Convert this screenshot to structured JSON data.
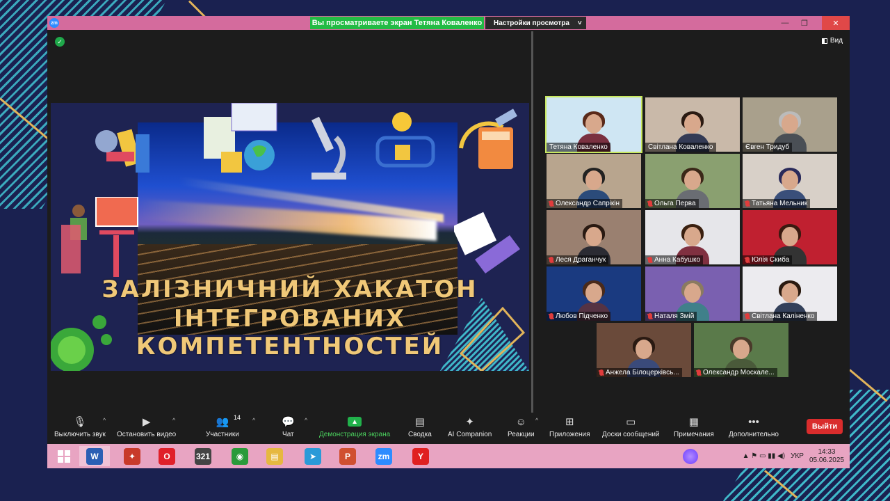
{
  "titlebar": {
    "logo": "zm",
    "banner": "Вы просматриваете экран Тетяна  Коваленко",
    "settings": "Настройки просмотра",
    "settings_caret": "˅",
    "min": "—",
    "restore": "❐",
    "close": "✕"
  },
  "view_button": "Вид",
  "slide": {
    "line1": "ЗАЛІЗНИЧНИЙ ХАКАТОН",
    "line2": "ІНТЕГРОВАНИХ",
    "line3": "КОМПЕТЕНТНОСТЕЙ"
  },
  "participants": [
    {
      "name": "Тетяна  Коваленко",
      "muted": false,
      "bg": "#cfe6f3",
      "hair": "#5a2a1a",
      "body": "#7a3040"
    },
    {
      "name": "Світлана Коваленко",
      "muted": false,
      "bg": "#c9b9a9",
      "hair": "#2a1a12",
      "body": "#333a55"
    },
    {
      "name": "Євген Тридуб",
      "muted": false,
      "bg": "#a9a08c",
      "hair": "#bbb",
      "body": "#4a4f55"
    },
    {
      "name": "Олександр Сапрікін",
      "muted": true,
      "bg": "#b8a58e",
      "hair": "#222",
      "body": "#2b4b7a"
    },
    {
      "name": "Ольга Перва",
      "muted": true,
      "bg": "#8aa070",
      "hair": "#3a2718",
      "body": "#6a6d73"
    },
    {
      "name": "Татьяна Мельник",
      "muted": true,
      "bg": "#d8d0c8",
      "hair": "#2a2a5a",
      "body": "#3a4f7a"
    },
    {
      "name": "Леся Драганчук",
      "muted": true,
      "bg": "#9a8070",
      "hair": "#2a1a12",
      "body": "#2b2b33"
    },
    {
      "name": "Анна Кабушко",
      "muted": true,
      "bg": "#e6e6ea",
      "hair": "#3a2010",
      "body": "#803040"
    },
    {
      "name": "Юлія Скиба",
      "muted": true,
      "bg": "#c02030",
      "hair": "#3a1a10",
      "body": "#333"
    },
    {
      "name": "Любов Підченко",
      "muted": true,
      "bg": "#1a3a80",
      "hair": "#4a2a1a",
      "body": "#553344"
    },
    {
      "name": "Наталя Змій",
      "muted": true,
      "bg": "#7a60b0",
      "hair": "#8a7a60",
      "body": "#40808a"
    },
    {
      "name": "Світлана Каліненко",
      "muted": true,
      "bg": "#ecebef",
      "hair": "#2a1a10",
      "body": "#33405a"
    },
    {
      "name": "Анжела Білоцерківсь...",
      "muted": true,
      "bg": "#6a4a3a",
      "hair": "#2a1a12",
      "body": "#3a4a7a"
    },
    {
      "name": "Олександр Москале...",
      "muted": true,
      "bg": "#5a7a4a",
      "hair": "#4a3a2a",
      "body": "#4a5a3a"
    }
  ],
  "toolbar": {
    "mute": "Выключить звук",
    "stop_video": "Остановить видео",
    "participants": "Участники",
    "participants_count": "14",
    "chat": "Чат",
    "share": "Демонстрация экрана",
    "summary": "Сводка",
    "ai": "AI Companion",
    "reactions": "Реакции",
    "apps": "Приложения",
    "whiteboards": "Доски сообщений",
    "notes": "Примечания",
    "more": "Дополнительно",
    "leave": "Выйти"
  },
  "taskbar": {
    "apps": [
      {
        "name": "word",
        "label": "W",
        "color": "#2b5fb4"
      },
      {
        "name": "app-red",
        "label": "✦",
        "color": "#c83a2a"
      },
      {
        "name": "opera",
        "label": "O",
        "color": "#e0202a"
      },
      {
        "name": "media-player",
        "label": "321",
        "color": "#444"
      },
      {
        "name": "chrome",
        "label": "◉",
        "color": "#2a9a3a"
      },
      {
        "name": "file-explorer",
        "label": "▤",
        "color": "#e6b840"
      },
      {
        "name": "telegram",
        "label": "➤",
        "color": "#2a9ad8"
      },
      {
        "name": "powerpoint",
        "label": "P",
        "color": "#d05030"
      },
      {
        "name": "zoom",
        "label": "zm",
        "color": "#2d8cff"
      },
      {
        "name": "yandex",
        "label": "Y",
        "color": "#e02020"
      }
    ],
    "tray_icons": "▲ ⚑ ▭ ▮▮ ◀)",
    "lang": "УКР",
    "time": "14:33",
    "date": "05.06.2025"
  }
}
